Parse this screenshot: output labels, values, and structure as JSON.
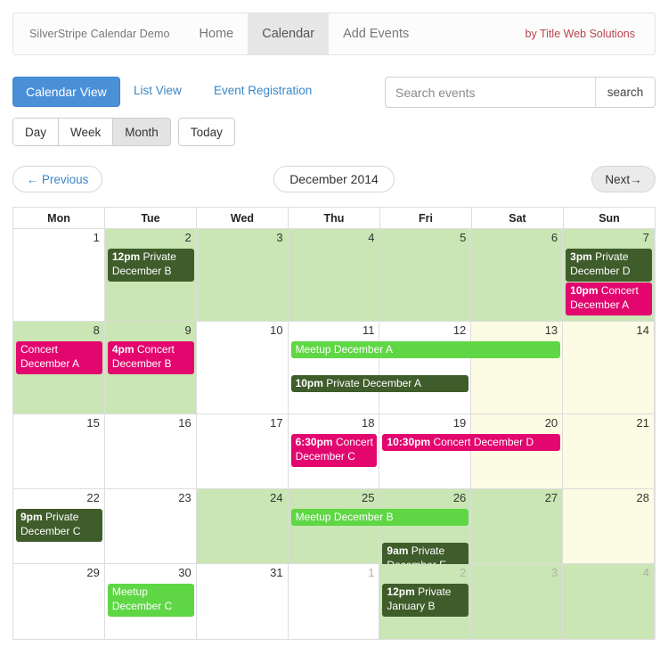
{
  "navbar": {
    "brand": "SilverStripe Calendar Demo",
    "items": [
      {
        "label": "Home",
        "active": false
      },
      {
        "label": "Calendar",
        "active": true
      },
      {
        "label": "Add Events",
        "active": false
      }
    ],
    "credit": "by Title Web Solutions"
  },
  "toolbar": {
    "calendar_view": "Calendar View",
    "list_view": "List View",
    "event_registration": "Event Registration",
    "search_placeholder": "Search events",
    "search_value": "",
    "search_button": "search"
  },
  "range": {
    "day": "Day",
    "week": "Week",
    "month": "Month",
    "today": "Today",
    "active": "Month"
  },
  "nav": {
    "previous": "← Previous",
    "title": "December 2014",
    "next": "Next→"
  },
  "colors": {
    "primary": "#4a90d9",
    "link": "#3a87c8",
    "credit": "#b8434f",
    "private": "#3f5c2b",
    "concert": "#e3066f",
    "meetup": "#5fd745",
    "cell_green": "#c9e6b4",
    "cell_cream": "#fcfbe3",
    "cell_white": "#ffffff"
  },
  "calendar": {
    "weekday_headers": [
      "Mon",
      "Tue",
      "Wed",
      "Thu",
      "Fri",
      "Sat",
      "Sun"
    ],
    "weeks": [
      {
        "height": "tall",
        "days": [
          {
            "num": "1",
            "bg": "white",
            "other": false
          },
          {
            "num": "2",
            "bg": "green",
            "other": false
          },
          {
            "num": "3",
            "bg": "green",
            "other": false
          },
          {
            "num": "4",
            "bg": "green",
            "other": false
          },
          {
            "num": "5",
            "bg": "green",
            "other": false
          },
          {
            "num": "6",
            "bg": "green",
            "other": false
          },
          {
            "num": "7",
            "bg": "green",
            "other": false
          }
        ],
        "events": [
          {
            "time": "12pm",
            "title": "Private December B",
            "type": "private",
            "col": 1,
            "span": 1,
            "row": 0,
            "lines": 2
          },
          {
            "time": "3pm",
            "title": "Private December D",
            "type": "private",
            "col": 6,
            "span": 1,
            "row": 0,
            "lines": 2
          },
          {
            "time": "10pm",
            "title": "Concert December A",
            "type": "concert",
            "col": 6,
            "span": 1,
            "row": 1,
            "lines": 2
          }
        ]
      },
      {
        "height": "tall",
        "days": [
          {
            "num": "8",
            "bg": "green",
            "other": false
          },
          {
            "num": "9",
            "bg": "green",
            "other": false
          },
          {
            "num": "10",
            "bg": "white",
            "other": false
          },
          {
            "num": "11",
            "bg": "white",
            "other": false
          },
          {
            "num": "12",
            "bg": "white",
            "other": false
          },
          {
            "num": "13",
            "bg": "cream",
            "other": false
          },
          {
            "num": "14",
            "bg": "cream",
            "other": false
          }
        ],
        "events": [
          {
            "time": "",
            "title": "Concert December A",
            "type": "concert",
            "col": 0,
            "span": 1,
            "row": 0,
            "lines": 2
          },
          {
            "time": "4pm",
            "title": "Concert December B",
            "type": "concert",
            "col": 1,
            "span": 1,
            "row": 0,
            "lines": 2
          },
          {
            "time": "",
            "title": "Meetup December A",
            "type": "meetup",
            "col": 3,
            "span": 3,
            "row": 0,
            "lines": 1
          },
          {
            "time": "10pm",
            "title": "Private December A",
            "type": "private",
            "col": 3,
            "span": 2,
            "row": 1,
            "lines": 1
          }
        ]
      },
      {
        "height": "std",
        "days": [
          {
            "num": "15",
            "bg": "white",
            "other": false
          },
          {
            "num": "16",
            "bg": "white",
            "other": false
          },
          {
            "num": "17",
            "bg": "white",
            "other": false
          },
          {
            "num": "18",
            "bg": "white",
            "other": false
          },
          {
            "num": "19",
            "bg": "white",
            "other": false
          },
          {
            "num": "20",
            "bg": "cream",
            "other": false
          },
          {
            "num": "21",
            "bg": "cream",
            "other": false
          }
        ],
        "events": [
          {
            "time": "6:30pm",
            "title": "Concert December C",
            "type": "concert",
            "col": 3,
            "span": 1,
            "row": 0,
            "lines": 2
          },
          {
            "time": "10:30pm",
            "title": "Concert December D",
            "type": "concert",
            "col": 4,
            "span": 2,
            "row": 0,
            "lines": 1
          }
        ]
      },
      {
        "height": "std",
        "days": [
          {
            "num": "22",
            "bg": "white",
            "other": false
          },
          {
            "num": "23",
            "bg": "white",
            "other": false
          },
          {
            "num": "24",
            "bg": "green",
            "other": false
          },
          {
            "num": "25",
            "bg": "green",
            "other": false
          },
          {
            "num": "26",
            "bg": "green",
            "other": false
          },
          {
            "num": "27",
            "bg": "green",
            "other": false
          },
          {
            "num": "28",
            "bg": "cream",
            "other": false
          }
        ],
        "events": [
          {
            "time": "9pm",
            "title": "Private December C",
            "type": "private",
            "col": 0,
            "span": 1,
            "row": 0,
            "lines": 2
          },
          {
            "time": "",
            "title": "Meetup December B",
            "type": "meetup",
            "col": 3,
            "span": 2,
            "row": 0,
            "lines": 1
          },
          {
            "time": "9am",
            "title": "Private December E",
            "type": "private",
            "col": 4,
            "span": 1,
            "row": 1,
            "lines": 2
          }
        ]
      },
      {
        "height": "std",
        "days": [
          {
            "num": "29",
            "bg": "white",
            "other": false
          },
          {
            "num": "30",
            "bg": "white",
            "other": false
          },
          {
            "num": "31",
            "bg": "white",
            "other": false
          },
          {
            "num": "1",
            "bg": "white",
            "other": true
          },
          {
            "num": "2",
            "bg": "green",
            "other": true
          },
          {
            "num": "3",
            "bg": "green",
            "other": true
          },
          {
            "num": "4",
            "bg": "green",
            "other": true
          }
        ],
        "events": [
          {
            "time": "",
            "title": "Meetup December C",
            "type": "meetup",
            "col": 1,
            "span": 1,
            "row": 0,
            "lines": 2
          },
          {
            "time": "12pm",
            "title": "Private January B",
            "type": "private",
            "col": 4,
            "span": 1,
            "row": 0,
            "lines": 2
          }
        ]
      }
    ]
  }
}
